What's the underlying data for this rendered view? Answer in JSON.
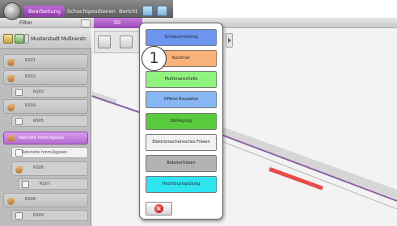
{
  "menu": {
    "tabs": [
      {
        "label": "Bearbeitung",
        "active": true
      },
      {
        "label": "Schachtpositionen",
        "active": false
      },
      {
        "label": "Bericht",
        "active": false
      }
    ]
  },
  "ribbon": {
    "filter_label": "Filter",
    "purple_tab_label": "3D"
  },
  "left_panel": {
    "title": "Musterstadt Mußnerstr.",
    "items": [
      {
        "label": "RS01"
      },
      {
        "label": "RS02"
      },
      {
        "label": "RS03"
      },
      {
        "label": "RS04"
      },
      {
        "label": "RS05"
      },
      {
        "label": "Robinete hmm/ligaseo",
        "selected": true
      },
      {
        "label": "Robinete hmm/ligaseo"
      },
      {
        "label": "RS06"
      },
      {
        "label": "RS07"
      },
      {
        "label": "RS08"
      },
      {
        "label": "RS09"
      }
    ]
  },
  "popup": {
    "callout_number": "1",
    "options": [
      {
        "label": "Schlauchrelining",
        "color": "#6b96f0"
      },
      {
        "label": "Kurzliner",
        "color": "#f9b27a"
      },
      {
        "label": "Muffenanschelle",
        "color": "#8ef27c"
      },
      {
        "label": "Offene Bauweise",
        "color": "#86b6f3"
      },
      {
        "label": "Stilllegung",
        "color": "#59cc3d"
      },
      {
        "label": "Elektromechanisches Fräsen",
        "color": "#f0f0f0"
      },
      {
        "label": "Roboterfräsen",
        "color": "#b3b3b3"
      },
      {
        "label": "Hochdruckspülung",
        "color": "#2ee4ef"
      }
    ]
  },
  "colors": {
    "accent_purple": "#9a47b5",
    "pipe": "#8b5fa6",
    "pipe_highlight": "#e94b4b"
  }
}
